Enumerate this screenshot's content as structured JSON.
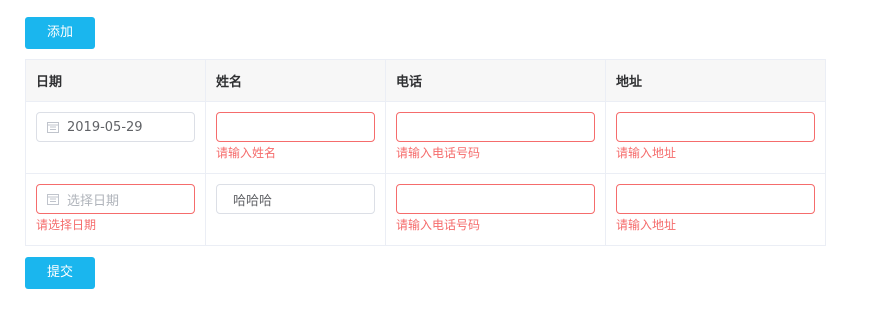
{
  "toolbar": {
    "add_label": "添加",
    "submit_label": "提交"
  },
  "table": {
    "headers": [
      "日期",
      "姓名",
      "电话",
      "地址"
    ],
    "rows": [
      {
        "date": {
          "value": "2019-05-29",
          "placeholder": "",
          "error": ""
        },
        "name": {
          "value": "",
          "error": "请输入姓名"
        },
        "phone": {
          "value": "",
          "error": "请输入电话号码"
        },
        "address": {
          "value": "",
          "error": "请输入地址"
        }
      },
      {
        "date": {
          "value": "",
          "placeholder": "选择日期",
          "error": "请选择日期"
        },
        "name": {
          "value": "哈哈哈",
          "error": ""
        },
        "phone": {
          "value": "",
          "error": "请输入电话号码"
        },
        "address": {
          "value": "",
          "error": "请输入地址"
        }
      }
    ]
  },
  "colors": {
    "primary": "#1ab6ee",
    "error": "#f56c6c",
    "border": "#dcdfe6",
    "header_bg": "#f7f7f7"
  },
  "icons": {
    "date": "calendar-icon"
  }
}
